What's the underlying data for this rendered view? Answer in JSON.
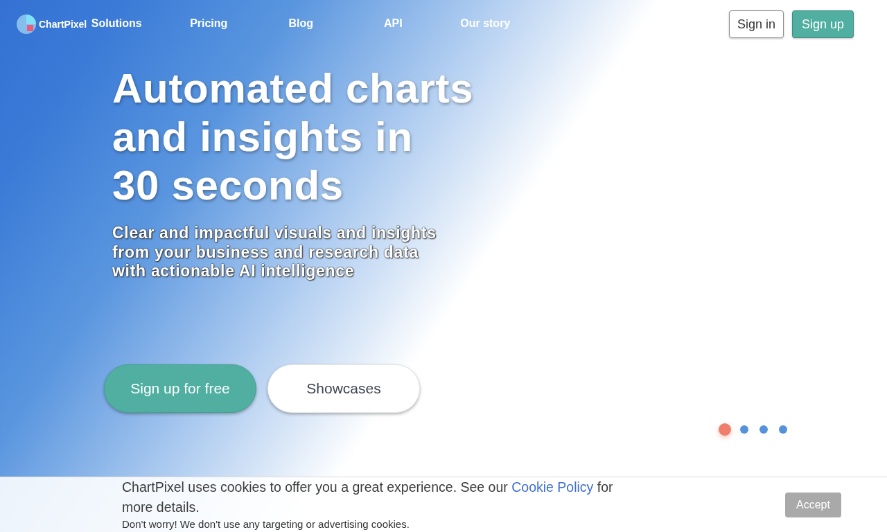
{
  "nav": {
    "brand": "ChartPixel",
    "links": [
      "Solutions",
      "Pricing",
      "Blog",
      "API",
      "Our story"
    ],
    "buttons": [
      {
        "label": "Sign in",
        "kind": "outline"
      },
      {
        "label": "Sign up",
        "kind": "primary"
      }
    ]
  },
  "hero": {
    "headline_lines": [
      "Automated charts",
      "and insights in",
      "30 seconds"
    ],
    "subtitle_lines": [
      "Clear and impactful visuals and insights",
      "from your business and research data",
      "with actionable AI intelligence"
    ],
    "buttons": [
      {
        "label": "Sign up for free",
        "kind": "primary"
      },
      {
        "label": "Showcases",
        "kind": "light"
      }
    ],
    "carousel_dots": [
      {
        "selected": true
      },
      {
        "selected": false
      },
      {
        "selected": false
      },
      {
        "selected": false
      }
    ]
  },
  "cookie_banner": {
    "text_before": "ChartPixel uses cookies to offer you a great experience. See our",
    "link": "Cookie Policy",
    "text_after": "for more details.",
    "note": "Don't worry! We don't use any targeting or advertising cookies.",
    "button": "Accept"
  }
}
